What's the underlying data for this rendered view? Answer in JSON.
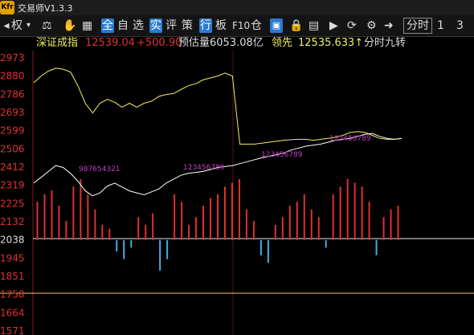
{
  "app": {
    "logo": "Kfr",
    "title": "交易师V1.3.3"
  },
  "toolbar": {
    "quan": "权",
    "items": [
      "全",
      "自",
      "选",
      "实",
      "评",
      "策",
      "行",
      "板",
      "F10",
      "仓"
    ],
    "blue_items": [
      "全",
      "实",
      "行"
    ],
    "period_selected": "分时",
    "period_1": "1",
    "period_3": "3"
  },
  "info": {
    "index_name": "深证成指",
    "price": "12539.04",
    "change": "+500.90",
    "volume_label": "预估量6053.08亿",
    "lead_label": "领先",
    "lead_value": "12535.633↑",
    "indicator": "分时九转"
  },
  "chart_data": {
    "type": "line",
    "y_ticks": [
      "2973",
      "2880",
      "2786",
      "2693",
      "2599",
      "2506",
      "2412",
      "2319",
      "2225",
      "2132",
      "2038",
      "1945",
      "1851",
      "1758",
      "1664",
      "1571"
    ],
    "ylim": [
      1571,
      2973
    ],
    "baseline": 2038,
    "series": [
      {
        "name": "",
        "color": "#f0f060",
        "values": [
          2845,
          2880,
          2905,
          2920,
          2915,
          2900,
          2830,
          2740,
          2690,
          2740,
          2760,
          2745,
          2720,
          2740,
          2720,
          2740,
          2750,
          2775,
          2785,
          2790,
          2810,
          2830,
          2840,
          2860,
          2870,
          2880,
          2895,
          2880,
          2530,
          2530,
          2530,
          2535,
          2540,
          2545,
          2550,
          2553,
          2555,
          2555,
          2550,
          2555,
          2560,
          2565,
          2575,
          2590,
          2595,
          2590,
          2575,
          2560,
          2555,
          2555,
          2560
        ]
      },
      {
        "name": "",
        "color": "#ffffff",
        "values": [
          2330,
          2360,
          2390,
          2420,
          2410,
          2380,
          2340,
          2290,
          2265,
          2280,
          2315,
          2330,
          2310,
          2290,
          2280,
          2270,
          2285,
          2300,
          2330,
          2350,
          2370,
          2380,
          2385,
          2390,
          2400,
          2410,
          2415,
          2420,
          2430,
          2440,
          2450,
          2460,
          2468,
          2476,
          2485,
          2500,
          2510,
          2520,
          2525,
          2530,
          2540,
          2550,
          2555,
          2560,
          2570,
          2580,
          2585,
          2570,
          2560,
          2555,
          2560
        ]
      }
    ],
    "volume_bars": [
      50,
      60,
      65,
      45,
      25,
      70,
      80,
      60,
      40,
      20,
      15,
      -15,
      -25,
      -10,
      30,
      20,
      35,
      -40,
      -25,
      60,
      50,
      20,
      30,
      45,
      55,
      60,
      70,
      75,
      80,
      40,
      25,
      -20,
      -30,
      20,
      30,
      45,
      50,
      60,
      40,
      30,
      -10,
      60,
      70,
      80,
      75,
      70,
      50,
      -20,
      30,
      40,
      45
    ],
    "countdown_markers": [
      {
        "labels": "9 8 7 6 5 4 3 2 1",
        "color": "#c040c0"
      },
      {
        "labels": "1 2 3 4 5 6 7 8 9",
        "color": "#c040c0"
      },
      {
        "labels": "1 2 3 4 5 6 7 8 9",
        "color": "#c040c0"
      },
      {
        "labels": "1 2 3 4 5 6 7 8 9",
        "color": "#c040c0"
      }
    ]
  },
  "colors": {
    "up": "#e03030",
    "down": "#40b0e0",
    "accent": "#f0f060",
    "blue": "#2a7ad2"
  }
}
